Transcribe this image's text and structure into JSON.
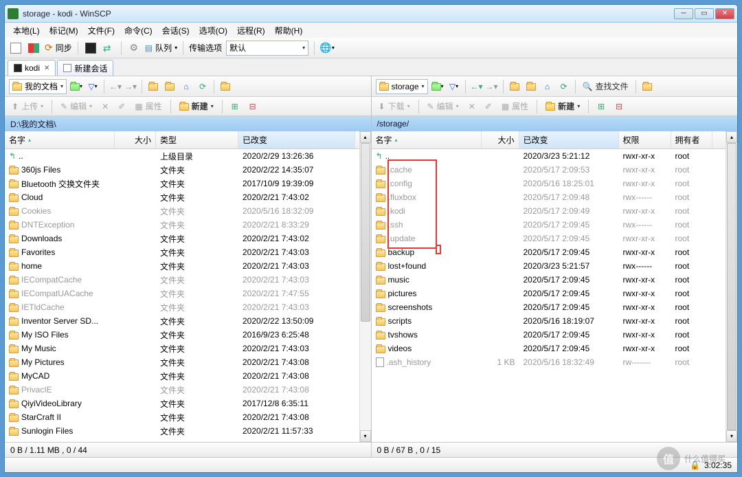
{
  "window": {
    "title": "storage - kodi - WinSCP"
  },
  "menu": {
    "local": "本地(L)",
    "mark": "标记(M)",
    "file": "文件(F)",
    "cmd": "命令(C)",
    "session": "会话(S)",
    "opts": "选项(O)",
    "remote": "远程(R)",
    "help": "帮助(H)"
  },
  "toolbar": {
    "sync": "同步",
    "queue": "队列",
    "transfer_label": "传输选项",
    "transfer_value": "默认"
  },
  "tabs": {
    "kodi": "kodi",
    "new": "新建会话"
  },
  "left": {
    "drive": "我的文档",
    "path": "D:\\我的文档\\",
    "actions": {
      "upload": "上传",
      "edit": "编辑",
      "props": "属性",
      "new": "新建"
    },
    "cols": {
      "name": "名字",
      "size": "大小",
      "type": "类型",
      "changed": "已改变"
    },
    "col_widths": {
      "name": 160,
      "size": 60,
      "type": 120,
      "changed": 170
    },
    "rows": [
      {
        "name": "..",
        "type": "上级目录",
        "changed": "2020/2/29  13:26:36",
        "dim": false,
        "icon": "up"
      },
      {
        "name": "360js Files",
        "type": "文件夹",
        "changed": "2020/2/22  14:35:07"
      },
      {
        "name": "Bluetooth 交换文件夹",
        "type": "文件夹",
        "changed": "2017/10/9  19:39:09"
      },
      {
        "name": "Cloud",
        "type": "文件夹",
        "changed": "2020/2/21  7:43:02"
      },
      {
        "name": "Cookies",
        "type": "文件夹",
        "changed": "2020/5/16  18:32:09",
        "dim": true
      },
      {
        "name": "DNTException",
        "type": "文件夹",
        "changed": "2020/2/21  8:33:29",
        "dim": true
      },
      {
        "name": "Downloads",
        "type": "文件夹",
        "changed": "2020/2/21  7:43:02"
      },
      {
        "name": "Favorites",
        "type": "文件夹",
        "changed": "2020/2/21  7:43:03"
      },
      {
        "name": "home",
        "type": "文件夹",
        "changed": "2020/2/21  7:43:03"
      },
      {
        "name": "IECompatCache",
        "type": "文件夹",
        "changed": "2020/2/21  7:43:03",
        "dim": true
      },
      {
        "name": "IECompatUACache",
        "type": "文件夹",
        "changed": "2020/2/21  7:47:55",
        "dim": true
      },
      {
        "name": "IETldCache",
        "type": "文件夹",
        "changed": "2020/2/21  7:43:03",
        "dim": true
      },
      {
        "name": "Inventor Server SD...",
        "type": "文件夹",
        "changed": "2020/2/22  13:50:09"
      },
      {
        "name": "My ISO Files",
        "type": "文件夹",
        "changed": "2016/9/23  6:25:48"
      },
      {
        "name": "My Music",
        "type": "文件夹",
        "changed": "2020/2/21  7:43:03"
      },
      {
        "name": "My Pictures",
        "type": "文件夹",
        "changed": "2020/2/21  7:43:08"
      },
      {
        "name": "MyCAD",
        "type": "文件夹",
        "changed": "2020/2/21  7:43:08"
      },
      {
        "name": "PrivacIE",
        "type": "文件夹",
        "changed": "2020/2/21  7:43:08",
        "dim": true
      },
      {
        "name": "QiyiVideoLibrary",
        "type": "文件夹",
        "changed": "2017/12/8  6:35:11"
      },
      {
        "name": "StarCraft II",
        "type": "文件夹",
        "changed": "2020/2/21  7:43:08"
      },
      {
        "name": "Sunlogin Files",
        "type": "文件夹",
        "changed": "2020/2/21  11:57:33"
      }
    ],
    "status": "0 B / 1.11 MB ,  0 / 44"
  },
  "right": {
    "drive": "storage",
    "path": "/storage/",
    "find": "查找文件",
    "actions": {
      "download": "下载",
      "edit": "编辑",
      "props": "属性",
      "new": "新建"
    },
    "cols": {
      "name": "名字",
      "size": "大小",
      "changed": "已改变",
      "rights": "权限",
      "owner": "拥有者"
    },
    "col_widths": {
      "name": 160,
      "size": 55,
      "changed": 145,
      "rights": 76,
      "owner": 60
    },
    "rows": [
      {
        "name": "..",
        "changed": "2020/3/23 5:21:12",
        "rights": "rwxr-xr-x",
        "owner": "root",
        "icon": "up"
      },
      {
        "name": ".cache",
        "changed": "2020/5/17 2:09:53",
        "rights": "rwxr-xr-x",
        "owner": "root",
        "dim": true
      },
      {
        "name": ".config",
        "changed": "2020/5/16 18:25:01",
        "rights": "rwxr-xr-x",
        "owner": "root",
        "dim": true
      },
      {
        "name": ".fluxbox",
        "changed": "2020/5/17 2:09:48",
        "rights": "rwx------",
        "owner": "root",
        "dim": true
      },
      {
        "name": ".kodi",
        "changed": "2020/5/17 2:09:49",
        "rights": "rwxr-xr-x",
        "owner": "root",
        "dim": true
      },
      {
        "name": ".ssh",
        "changed": "2020/5/17 2:09:45",
        "rights": "rwx------",
        "owner": "root",
        "dim": true
      },
      {
        "name": ".update",
        "changed": "2020/5/17 2:09:45",
        "rights": "rwxr-xr-x",
        "owner": "root",
        "dim": true
      },
      {
        "name": "backup",
        "changed": "2020/5/17 2:09:45",
        "rights": "rwxr-xr-x",
        "owner": "root"
      },
      {
        "name": "lost+found",
        "changed": "2020/3/23 5:21:57",
        "rights": "rwx------",
        "owner": "root"
      },
      {
        "name": "music",
        "changed": "2020/5/17 2:09:45",
        "rights": "rwxr-xr-x",
        "owner": "root"
      },
      {
        "name": "pictures",
        "changed": "2020/5/17 2:09:45",
        "rights": "rwxr-xr-x",
        "owner": "root"
      },
      {
        "name": "screenshots",
        "changed": "2020/5/17 2:09:45",
        "rights": "rwxr-xr-x",
        "owner": "root"
      },
      {
        "name": "scripts",
        "changed": "2020/5/16 18:19:07",
        "rights": "rwxr-xr-x",
        "owner": "root"
      },
      {
        "name": "tvshows",
        "changed": "2020/5/17 2:09:45",
        "rights": "rwxr-xr-x",
        "owner": "root"
      },
      {
        "name": "videos",
        "changed": "2020/5/17 2:09:45",
        "rights": "rwxr-xr-x",
        "owner": "root"
      },
      {
        "name": ".ash_history",
        "size": "1 KB",
        "changed": "2020/5/16 18:32:49",
        "rights": "rw-------",
        "owner": "root",
        "dim": true,
        "icon": "file"
      }
    ],
    "status": "0 B / 67 B ,  0 / 15"
  },
  "sb2_time": "3:02:35",
  "watermark": "什么值得买"
}
